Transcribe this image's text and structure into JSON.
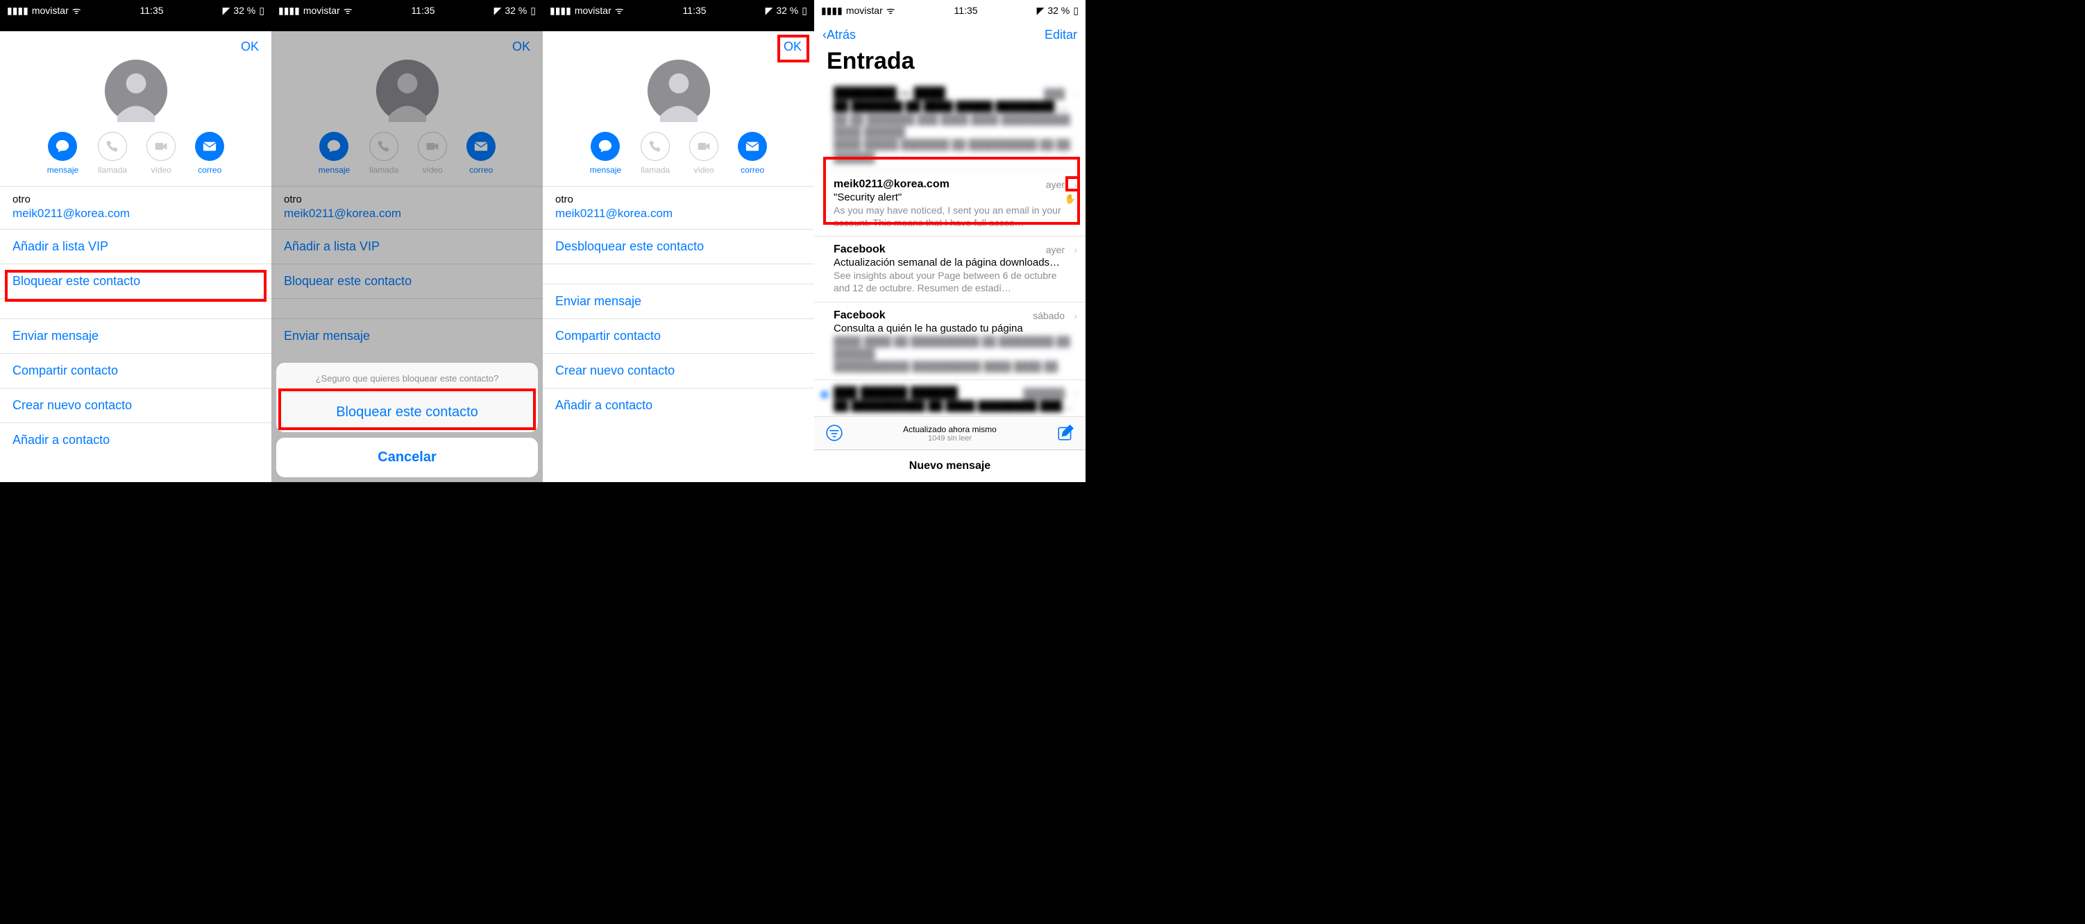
{
  "status": {
    "carrier": "movistar",
    "time": "11:35",
    "battery": "32 %"
  },
  "contact": {
    "ok": "OK",
    "actions": {
      "message": "mensaje",
      "call": "llamada",
      "video": "vídeo",
      "mail": "correo"
    },
    "other_label": "otro",
    "email": "meik0211@korea.com",
    "vip": "Añadir a lista VIP",
    "block": "Bloquear este contacto",
    "unblock": "Desbloquear este contacto",
    "send_msg": "Enviar mensaje",
    "share": "Compartir contacto",
    "create": "Crear nuevo contacto",
    "add": "Añadir a contacto"
  },
  "sheet": {
    "title": "¿Seguro que quieres bloquear este contacto?",
    "block": "Bloquear este contacto",
    "cancel": "Cancelar"
  },
  "mail": {
    "back": "Atrás",
    "edit": "Editar",
    "title": "Entrada",
    "items": [
      {
        "sender": "meik0211@korea.com",
        "time": "ayer",
        "subject": "\"Security alert\"",
        "preview": "As you may have noticed, I sent you an email in your account. This means that I have full acces…"
      },
      {
        "sender": "Facebook",
        "time": "ayer",
        "subject": "Actualización semanal de la página downloads…",
        "preview": "See insights about your Page between 6 de octubre and 12 de octubre. Resumen de estadí…"
      },
      {
        "sender": "Facebook",
        "time": "sábado",
        "subject": "Consulta a quién le ha gustado tu página",
        "preview": ""
      }
    ],
    "updated": "Actualizado ahora mismo",
    "unread": "1049 sin leer",
    "new_message": "Nuevo mensaje"
  }
}
